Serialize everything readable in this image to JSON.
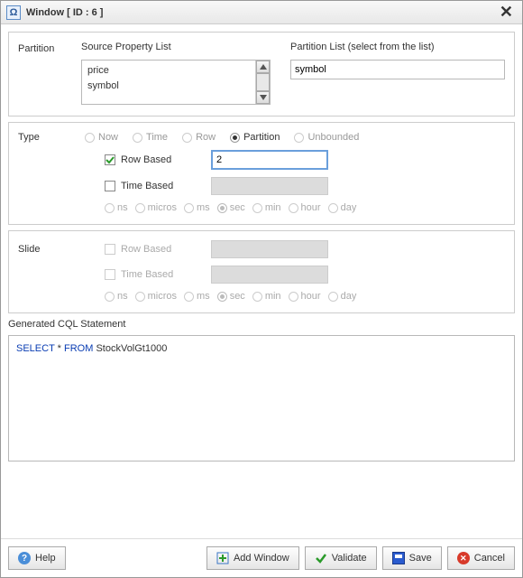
{
  "title": "Window [ ID : 6 ]",
  "partition": {
    "label": "Partition",
    "source_label": "Source Property List",
    "source_items": [
      "price",
      "symbol"
    ],
    "list_label": "Partition List (select from the list)",
    "list_value": "symbol"
  },
  "type": {
    "label": "Type",
    "options": {
      "now": "Now",
      "time": "Time",
      "row": "Row",
      "partition": "Partition",
      "unbounded": "Unbounded"
    },
    "selected": "partition",
    "row_based_label": "Row Based",
    "row_based_checked": true,
    "row_based_value": "2",
    "time_based_label": "Time Based",
    "time_based_checked": false,
    "units": {
      "ns": "ns",
      "micros": "micros",
      "ms": "ms",
      "sec": "sec",
      "min": "min",
      "hour": "hour",
      "day": "day"
    },
    "unit_selected": "sec"
  },
  "slide": {
    "label": "Slide",
    "row_based_label": "Row Based",
    "time_based_label": "Time Based",
    "units": {
      "ns": "ns",
      "micros": "micros",
      "ms": "ms",
      "sec": "sec",
      "min": "min",
      "hour": "hour",
      "day": "day"
    },
    "unit_selected": "sec"
  },
  "cql": {
    "label": "Generated CQL Statement",
    "kw_select": "SELECT",
    "star": " * ",
    "kw_from": "FROM",
    "rest": " StockVolGt1000"
  },
  "buttons": {
    "help": "Help",
    "add_window": "Add Window",
    "validate": "Validate",
    "save": "Save",
    "cancel": "Cancel"
  }
}
